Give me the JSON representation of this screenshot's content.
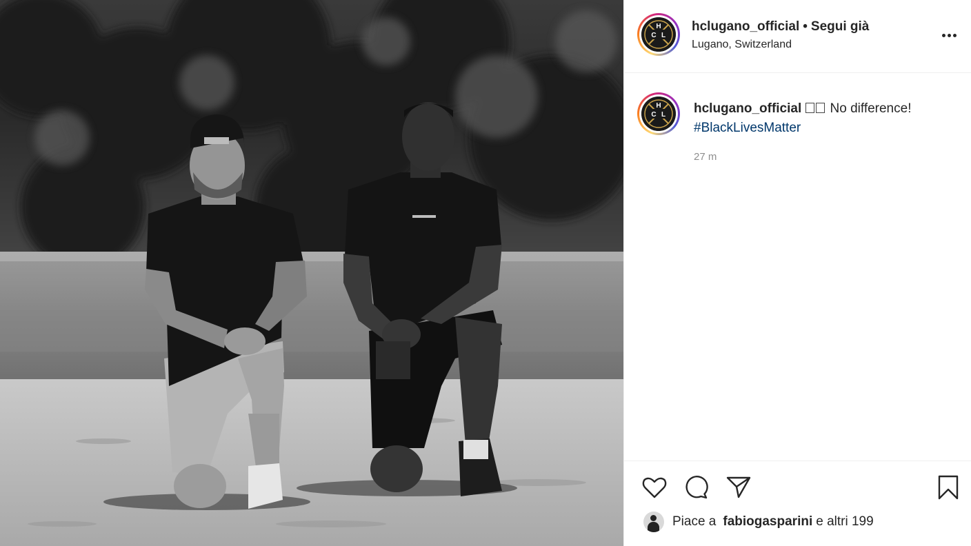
{
  "post": {
    "author": "hclugano_official",
    "follow_status": "Segui già",
    "separator": "•",
    "location": "Lugano, Switzerland",
    "avatar_logo_letters": [
      "H",
      "C",
      "L"
    ],
    "caption_text": "No difference!",
    "caption_hashtag": "#BlackLivesMatter",
    "timestamp": "27 m"
  },
  "likes": {
    "prefix": "Piace a",
    "user": "fabiogasparini",
    "suffix": "e altri 199"
  },
  "icons": {
    "more": "more-options-icon",
    "like": "heart-icon",
    "comment": "comment-icon",
    "share": "paper-plane-icon",
    "save": "bookmark-icon"
  },
  "colors": {
    "hashtag": "#00376b",
    "muted": "#8e8e8e",
    "text": "#262626"
  }
}
